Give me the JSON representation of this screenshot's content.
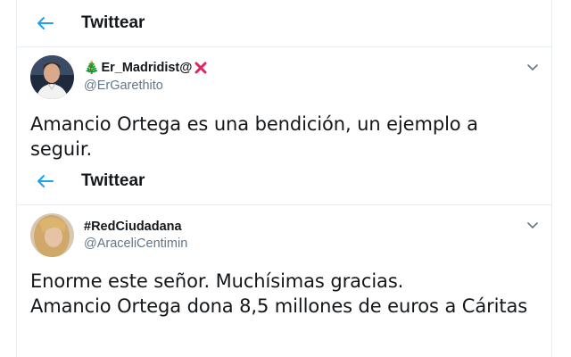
{
  "colors": {
    "accent": "#1da1f2",
    "border": "#e6ecf0",
    "handle": "#657786",
    "red_x": "#e0245e",
    "tree": "#2e8b3a"
  },
  "screens": [
    {
      "header": {
        "title": "Twittear",
        "back_icon": "back-arrow-icon"
      },
      "tweet": {
        "display_name": "Er_Madridist@",
        "name_prefix_emoji": "🎄",
        "name_suffix_icon": "red-x-icon",
        "handle": "@ErGarethito",
        "text": "Amancio Ortega es una bendición, un ejemplo a seguir."
      }
    },
    {
      "header": {
        "title": "Twittear",
        "back_icon": "back-arrow-icon"
      },
      "tweet": {
        "display_name": "#RedCiudadana",
        "handle": "@AraceliCentimin",
        "text_lines": [
          "Enorme este señor. Muchísimas gracias.",
          "Amancio Ortega dona 8,5 millones de euros a Cáritas"
        ]
      }
    }
  ]
}
